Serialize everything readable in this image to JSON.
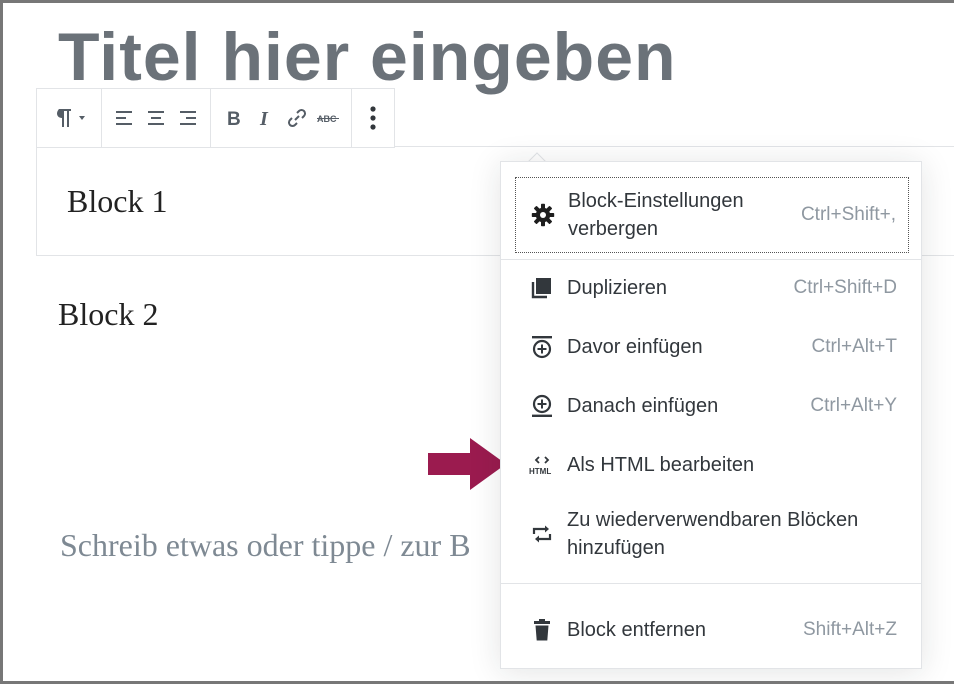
{
  "editor": {
    "title": "Titel hier eingeben",
    "block1": "Block 1",
    "block2": "Block 2",
    "placeholder": "Schreib etwas oder tippe / zur B"
  },
  "toolbar": {
    "buttons": [
      "paragraph-icon",
      "align-left-icon",
      "align-center-icon",
      "align-right-icon",
      "bold-icon",
      "italic-icon",
      "link-icon",
      "strikethrough-icon",
      "more-options-icon"
    ]
  },
  "menu": {
    "items": [
      {
        "label": "Block-Einstellungen verbergen",
        "shortcut": "Ctrl+Shift+,",
        "icon": "gear-icon"
      },
      {
        "label": "Duplizieren",
        "shortcut": "Ctrl+Shift+D",
        "icon": "duplicate-icon"
      },
      {
        "label": "Davor einfügen",
        "shortcut": "Ctrl+Alt+T",
        "icon": "insert-before-icon"
      },
      {
        "label": "Danach einfügen",
        "shortcut": "Ctrl+Alt+Y",
        "icon": "insert-after-icon"
      },
      {
        "label": "Als HTML bearbeiten",
        "shortcut": "",
        "icon": "html-icon"
      },
      {
        "label": "Zu wiederverwendbaren Blöcken hinzufügen",
        "shortcut": "",
        "icon": "reusable-icon"
      },
      {
        "label": "Block entfernen",
        "shortcut": "Shift+Alt+Z",
        "icon": "trash-icon"
      }
    ]
  },
  "colors": {
    "arrow": "#9b1b4f",
    "title": "#6b7279",
    "shortcut": "#8f98a1"
  }
}
